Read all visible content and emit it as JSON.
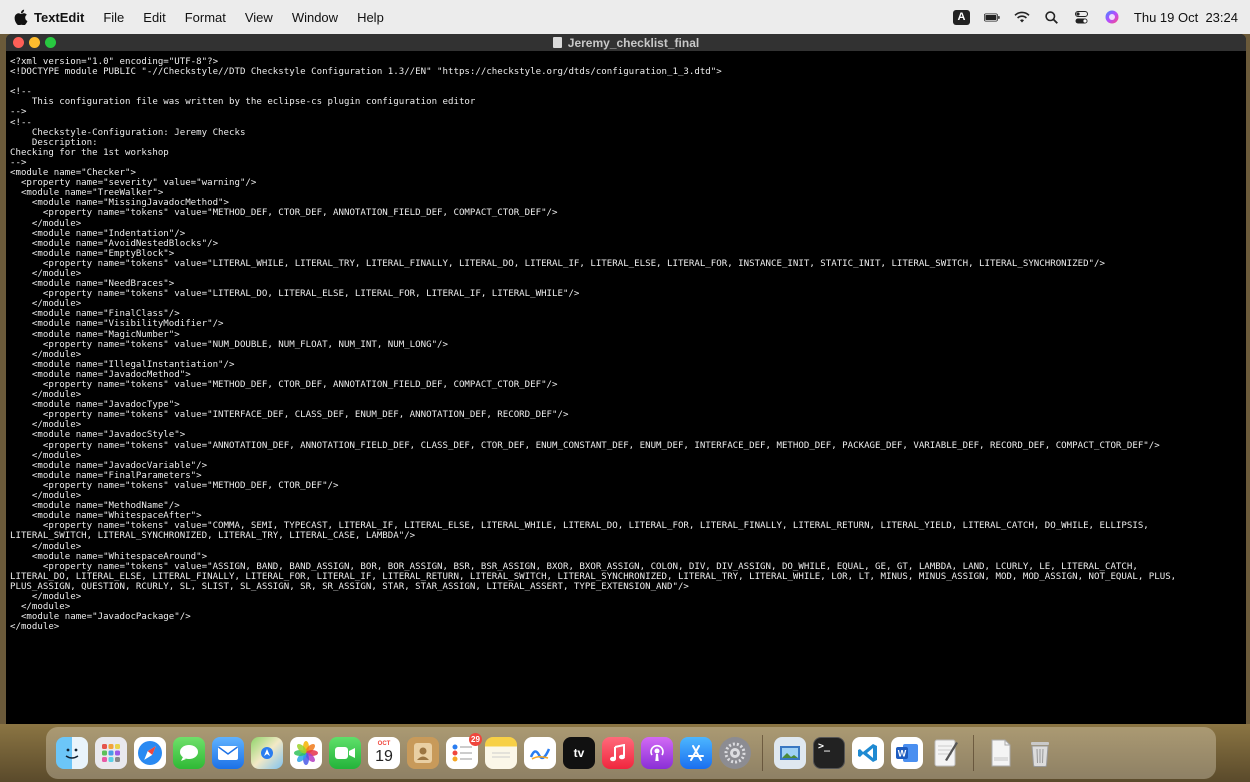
{
  "menubar": {
    "app_name": "TextEdit",
    "menus": [
      "File",
      "Edit",
      "Format",
      "View",
      "Window",
      "Help"
    ],
    "input_source": "A",
    "clock": "Thu 19 Oct  23:24"
  },
  "window": {
    "title": "Jeremy_checklist_final"
  },
  "document": {
    "lines": [
      "<?xml version=\"1.0\" encoding=\"UTF-8\"?>",
      "<!DOCTYPE module PUBLIC \"-//Checkstyle//DTD Checkstyle Configuration 1.3//EN\" \"https://checkstyle.org/dtds/configuration_1_3.dtd\">",
      "",
      "<!--",
      "    This configuration file was written by the eclipse-cs plugin configuration editor",
      "-->",
      "<!--",
      "    Checkstyle-Configuration: Jeremy Checks",
      "    Description:",
      "Checking for the 1st workshop",
      "-->",
      "<module name=\"Checker\">",
      "  <property name=\"severity\" value=\"warning\"/>",
      "  <module name=\"TreeWalker\">",
      "    <module name=\"MissingJavadocMethod\">",
      "      <property name=\"tokens\" value=\"METHOD_DEF, CTOR_DEF, ANNOTATION_FIELD_DEF, COMPACT_CTOR_DEF\"/>",
      "    </module>",
      "    <module name=\"Indentation\"/>",
      "    <module name=\"AvoidNestedBlocks\"/>",
      "    <module name=\"EmptyBlock\">",
      "      <property name=\"tokens\" value=\"LITERAL_WHILE, LITERAL_TRY, LITERAL_FINALLY, LITERAL_DO, LITERAL_IF, LITERAL_ELSE, LITERAL_FOR, INSTANCE_INIT, STATIC_INIT, LITERAL_SWITCH, LITERAL_SYNCHRONIZED\"/>",
      "    </module>",
      "    <module name=\"NeedBraces\">",
      "      <property name=\"tokens\" value=\"LITERAL_DO, LITERAL_ELSE, LITERAL_FOR, LITERAL_IF, LITERAL_WHILE\"/>",
      "    </module>",
      "    <module name=\"FinalClass\"/>",
      "    <module name=\"VisibilityModifier\"/>",
      "    <module name=\"MagicNumber\">",
      "      <property name=\"tokens\" value=\"NUM_DOUBLE, NUM_FLOAT, NUM_INT, NUM_LONG\"/>",
      "    </module>",
      "    <module name=\"IllegalInstantiation\"/>",
      "    <module name=\"JavadocMethod\">",
      "      <property name=\"tokens\" value=\"METHOD_DEF, CTOR_DEF, ANNOTATION_FIELD_DEF, COMPACT_CTOR_DEF\"/>",
      "    </module>",
      "    <module name=\"JavadocType\">",
      "      <property name=\"tokens\" value=\"INTERFACE_DEF, CLASS_DEF, ENUM_DEF, ANNOTATION_DEF, RECORD_DEF\"/>",
      "    </module>",
      "    <module name=\"JavadocStyle\">",
      "      <property name=\"tokens\" value=\"ANNOTATION_DEF, ANNOTATION_FIELD_DEF, CLASS_DEF, CTOR_DEF, ENUM_CONSTANT_DEF, ENUM_DEF, INTERFACE_DEF, METHOD_DEF, PACKAGE_DEF, VARIABLE_DEF, RECORD_DEF, COMPACT_CTOR_DEF\"/>",
      "    </module>",
      "    <module name=\"JavadocVariable\"/>",
      "    <module name=\"FinalParameters\">",
      "      <property name=\"tokens\" value=\"METHOD_DEF, CTOR_DEF\"/>",
      "    </module>",
      "    <module name=\"MethodName\"/>",
      "    <module name=\"WhitespaceAfter\">",
      "      <property name=\"tokens\" value=\"COMMA, SEMI, TYPECAST, LITERAL_IF, LITERAL_ELSE, LITERAL_WHILE, LITERAL_DO, LITERAL_FOR, LITERAL_FINALLY, LITERAL_RETURN, LITERAL_YIELD, LITERAL_CATCH, DO_WHILE, ELLIPSIS,",
      "LITERAL_SWITCH, LITERAL_SYNCHRONIZED, LITERAL_TRY, LITERAL_CASE, LAMBDA\"/>",
      "    </module>",
      "    <module name=\"WhitespaceAround\">",
      "      <property name=\"tokens\" value=\"ASSIGN, BAND, BAND_ASSIGN, BOR, BOR_ASSIGN, BSR, BSR_ASSIGN, BXOR, BXOR_ASSIGN, COLON, DIV, DIV_ASSIGN, DO_WHILE, EQUAL, GE, GT, LAMBDA, LAND, LCURLY, LE, LITERAL_CATCH,",
      "LITERAL_DO, LITERAL_ELSE, LITERAL_FINALLY, LITERAL_FOR, LITERAL_IF, LITERAL_RETURN, LITERAL_SWITCH, LITERAL_SYNCHRONIZED, LITERAL_TRY, LITERAL_WHILE, LOR, LT, MINUS, MINUS_ASSIGN, MOD, MOD_ASSIGN, NOT_EQUAL, PLUS,",
      "PLUS_ASSIGN, QUESTION, RCURLY, SL, SLIST, SL_ASSIGN, SR, SR_ASSIGN, STAR, STAR_ASSIGN, LITERAL_ASSERT, TYPE_EXTENSION_AND\"/>",
      "    </module>",
      "  </module>",
      "  <module name=\"JavadocPackage\"/>",
      "</module>"
    ]
  },
  "dock": {
    "calendar_month": "OCT",
    "calendar_day": "19",
    "reminders_badge": "29",
    "tv_label": "tv",
    "apps": [
      "Finder",
      "Launchpad",
      "Safari",
      "Messages",
      "Mail",
      "Maps",
      "Photos",
      "FaceTime",
      "Calendar",
      "Contacts",
      "Reminders",
      "Notes",
      "Freeform",
      "TV",
      "Music",
      "Podcasts",
      "App Store",
      "System Settings",
      "Preview",
      "Terminal",
      "Visual Studio Code",
      "Microsoft Word",
      "TextEdit",
      "Document",
      "Trash"
    ]
  }
}
